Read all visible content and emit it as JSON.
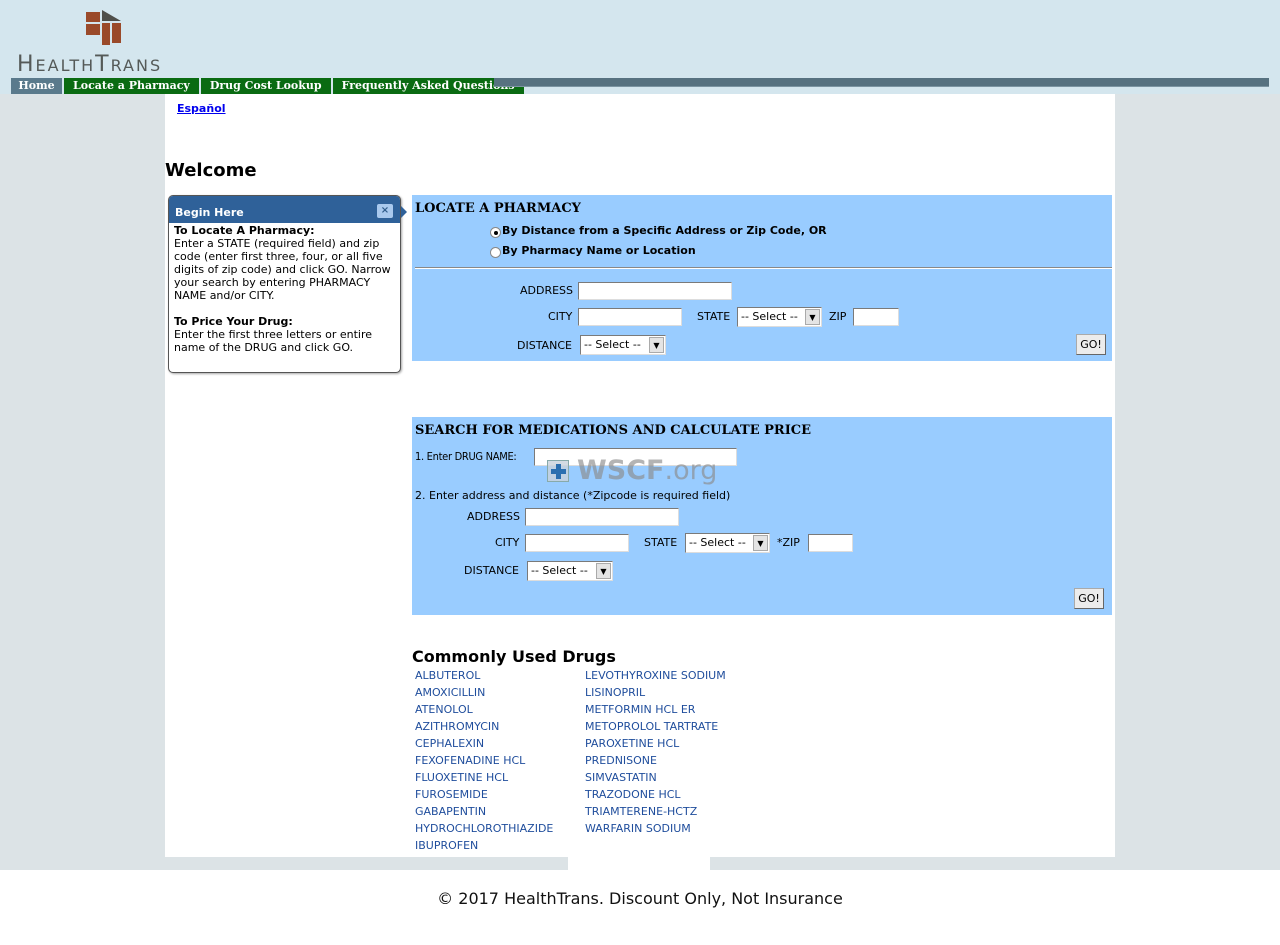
{
  "brand": {
    "logo_text": "HealthTrans",
    "colors": {
      "top_band": "#d4e6ee",
      "nav_home": "#5a7a8c",
      "nav_green": "#0a6b12",
      "panel_blue": "#99ccff",
      "help_header": "#2f6199",
      "link_blue": "#1f4d9c"
    }
  },
  "nav": {
    "items": [
      {
        "label": "Home"
      },
      {
        "label": "Locate a Pharmacy"
      },
      {
        "label": "Drug Cost Lookup"
      },
      {
        "label": "Frequently Asked Questions"
      }
    ]
  },
  "language_link": "Español",
  "page_title": "Welcome",
  "help_box": {
    "title": "Begin Here",
    "close_icon": "×",
    "section1_heading": "To Locate A Pharmacy:",
    "section1_text": "Enter a STATE (required field) and zip code (enter first three, four, or all five digits of zip code) and click GO. Narrow your search by entering PHARMACY NAME and/or CITY.",
    "section2_heading": "To Price Your Drug:",
    "section2_text": "Enter the first three letters or entire name of the DRUG and click GO."
  },
  "locate_pharmacy": {
    "title": "LOCATE A PHARMACY",
    "radio_options": [
      {
        "label": "By Distance from a Specific Address or Zip Code, OR",
        "checked": true
      },
      {
        "label": "By Pharmacy Name or Location",
        "checked": false
      }
    ],
    "address_label": "ADDRESS",
    "address_value": "",
    "city_label": "CITY",
    "city_value": "",
    "state_label": "STATE",
    "state_value": "-- Select --",
    "zip_label": "ZIP",
    "zip_value": "",
    "distance_label": "DISTANCE",
    "distance_value": "-- Select --",
    "go_label": "GO!"
  },
  "medication_search": {
    "title": "SEARCH FOR MEDICATIONS AND CALCULATE PRICE",
    "drug_name_label": "1. Enter DRUG NAME:",
    "drug_name_value": "",
    "step2_label": "2. Enter address and distance (*Zipcode is required field)",
    "address_label": "ADDRESS",
    "address_value": "",
    "city_label": "CITY",
    "city_value": "",
    "state_label": "STATE",
    "state_value": "-- Select --",
    "zip_label": "*ZIP",
    "zip_value": "",
    "distance_label": "DISTANCE",
    "distance_value": "-- Select --",
    "go_label": "GO!"
  },
  "watermark": {
    "text": "WSCF",
    "suffix": ".org"
  },
  "common_drugs": {
    "title": "Commonly Used Drugs",
    "column1": [
      "ALBUTEROL",
      "AMOXICILLIN",
      "ATENOLOL",
      "AZITHROMYCIN",
      "CEPHALEXIN",
      "FEXOFENADINE HCL",
      "FLUOXETINE HCL",
      "FUROSEMIDE",
      "GABAPENTIN",
      "HYDROCHLOROTHIAZIDE",
      "IBUPROFEN"
    ],
    "column2": [
      "LEVOTHYROXINE SODIUM",
      "LISINOPRIL",
      "METFORMIN HCL ER",
      "METOPROLOL TARTRATE",
      "PAROXETINE HCL",
      "PREDNISONE",
      "SIMVASTATIN",
      "TRAZODONE HCL",
      "TRIAMTERENE-HCTZ",
      "WARFARIN SODIUM"
    ]
  },
  "footer": "© 2017 HealthTrans. Discount Only, Not Insurance"
}
